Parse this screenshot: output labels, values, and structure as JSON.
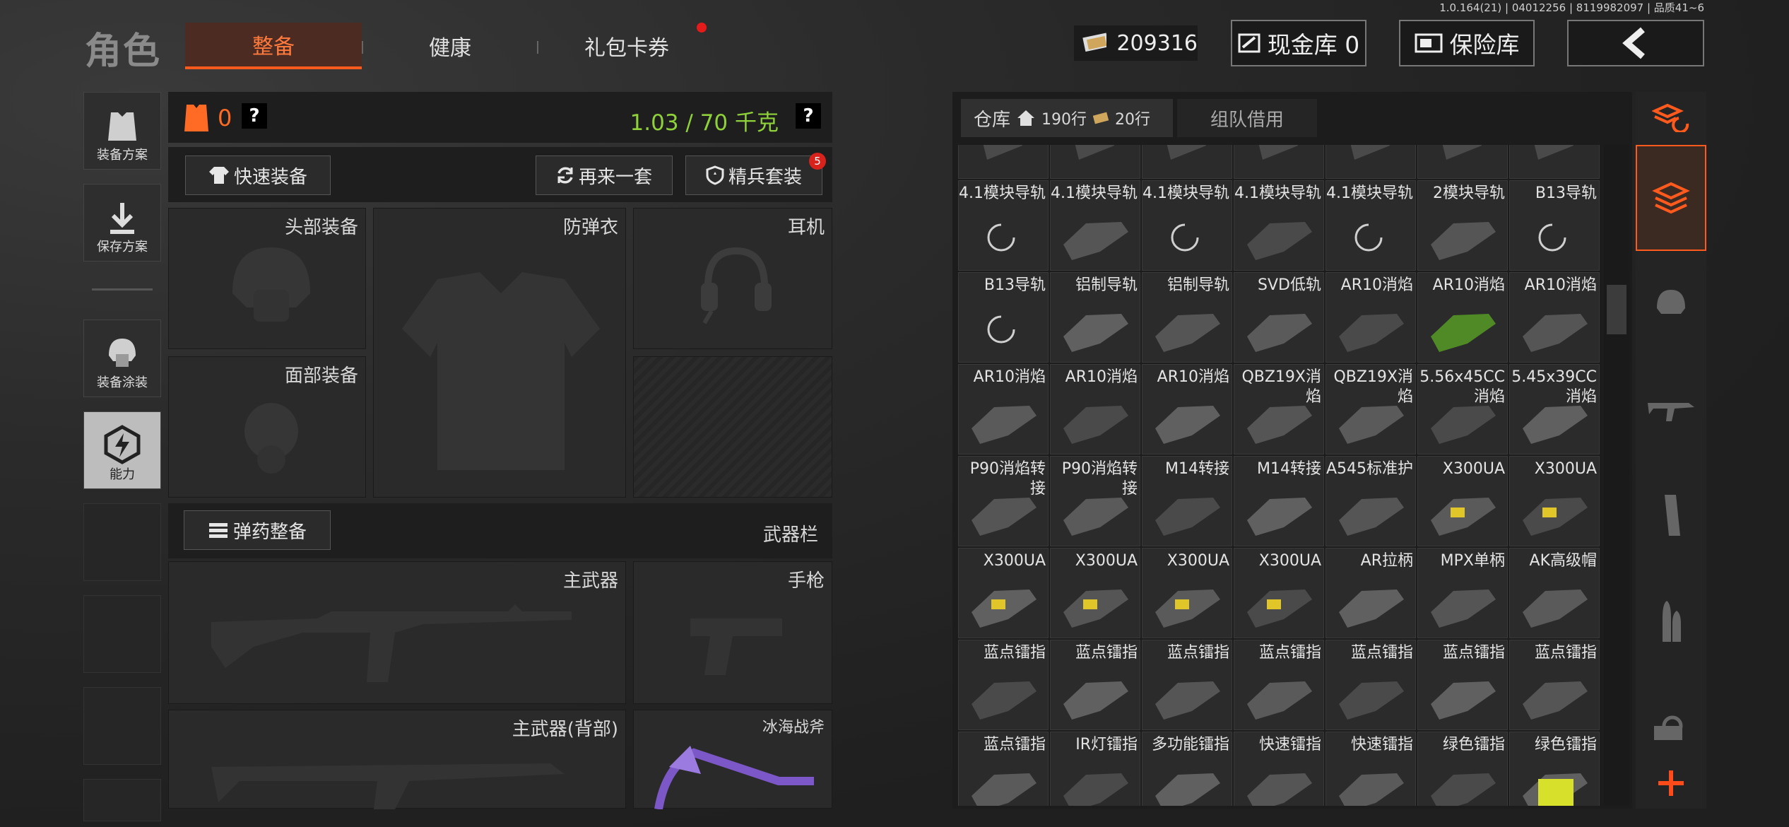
{
  "version": "1.0.164(21) | 04012256 | 8119982097 | 品质41~6",
  "page_title": "角色",
  "tabs": [
    {
      "label": "整备",
      "active": true
    },
    {
      "label": "健康"
    },
    {
      "label": "礼包卡券",
      "badge": true
    }
  ],
  "currency": "209316",
  "cash_store": "现金库 0",
  "safe_store": "保险库",
  "left_menu": {
    "equip_plan": "装备方案",
    "save_plan": "保存方案",
    "equip_paint": "装备涂装",
    "ability": "能力"
  },
  "loadout": {
    "armor_count": "0",
    "weight": "1.03 / 70 千克",
    "quick_equip": "快速装备",
    "again": "再来一套",
    "elite": "精兵套装",
    "elite_badge": "5",
    "head": "头部装备",
    "vest": "防弹衣",
    "headset": "耳机",
    "face": "面部装备",
    "ammo": "弹药整备",
    "weapon_bar": "武器栏",
    "primary": "主武器",
    "pistol": "手枪",
    "primary_back": "主武器(背部)",
    "melee": "冰海战斧"
  },
  "warehouse": {
    "label": "仓库",
    "rows": "190行",
    "rows2": "20行",
    "team_borrow": "组队借用"
  },
  "items": [
    "",
    "",
    "",
    "",
    "",
    "",
    "",
    "4.1模块导轨",
    "4.1模块导轨",
    "4.1模块导轨",
    "4.1模块导轨",
    "4.1模块导轨",
    "2模块导轨",
    "B13导轨",
    "B13导轨",
    "铝制导轨",
    "铝制导轨",
    "SVD低轨",
    "AR10消焰",
    "AR10消焰",
    "AR10消焰",
    "AR10消焰",
    "AR10消焰",
    "AR10消焰",
    "QBZ19X消焰",
    "QBZ19X消焰",
    "5.56x45CC消焰",
    "5.45x39CC消焰",
    "P90消焰转接",
    "P90消焰转接",
    "M14转接",
    "M14转接",
    "A545标准护",
    "X300UA",
    "X300UA",
    "X300UA",
    "X300UA",
    "X300UA",
    "X300UA",
    "AR拉柄",
    "MPX单柄",
    "AK高级帽",
    "蓝点镭指",
    "蓝点镭指",
    "蓝点镭指",
    "蓝点镭指",
    "蓝点镭指",
    "蓝点镭指",
    "蓝点镭指",
    "蓝点镭指",
    "IR灯镭指",
    "多功能镭指",
    "快速镭指",
    "快速镭指",
    "绿色镭指",
    "绿色镭指"
  ],
  "colors": {
    "accent": "#ff5a1e",
    "weight_green": "#8fd13a"
  }
}
